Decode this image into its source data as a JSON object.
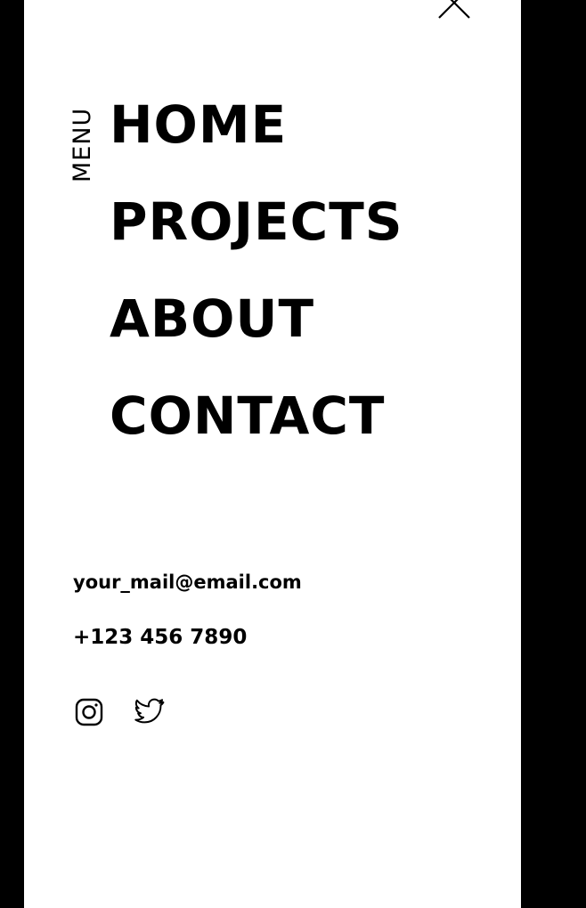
{
  "menu": {
    "label": "MENU",
    "close_icon": "close-icon",
    "items": [
      {
        "label": "HOME"
      },
      {
        "label": "PROJECTS"
      },
      {
        "label": "ABOUT"
      },
      {
        "label": "CONTACT"
      }
    ]
  },
  "contact": {
    "email": "your_mail@email.com",
    "phone": "+123 456 7890"
  },
  "socials": [
    {
      "icon": "instagram-icon"
    },
    {
      "icon": "twitter-icon"
    }
  ],
  "colors": {
    "background": "#000000",
    "panel": "#ffffff",
    "text": "#000000"
  }
}
